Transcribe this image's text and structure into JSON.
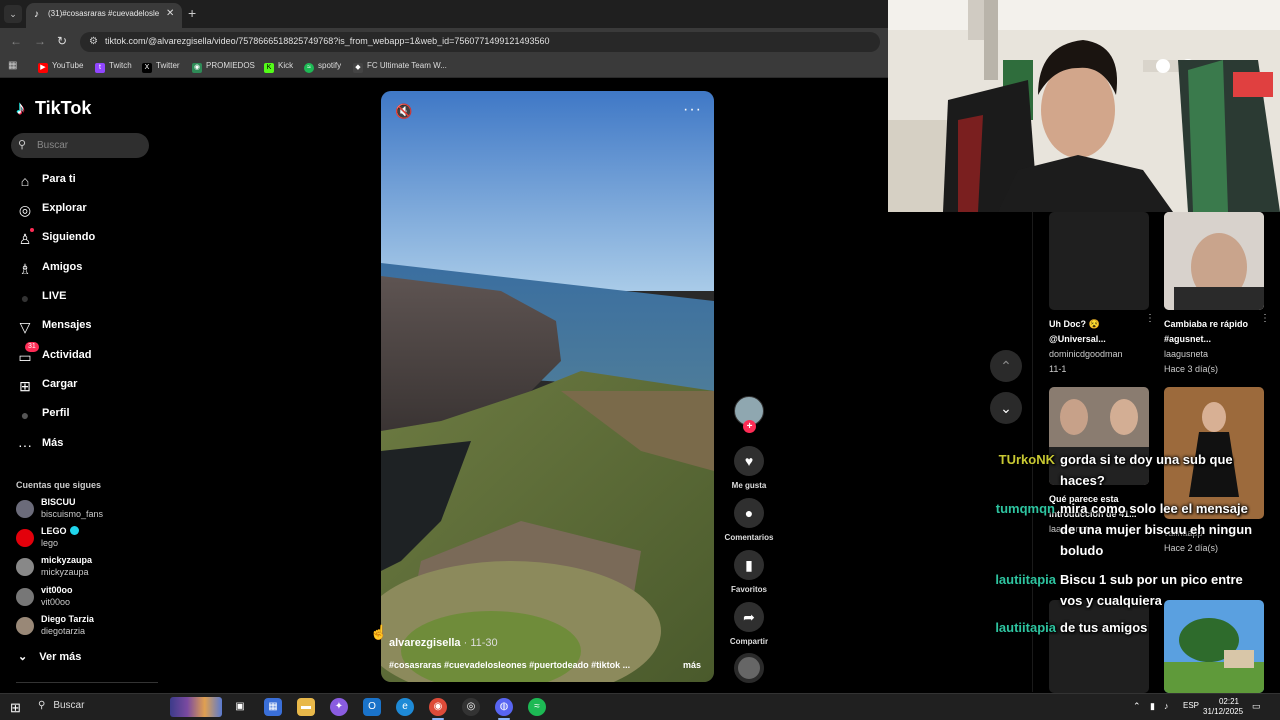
{
  "browser": {
    "tab_title": "(31)#cosasraras #cuevadelosle",
    "url": "tiktok.com/@alvarezgisella/video/7578666518825749768?is_from_webapp=1&web_id=7560771499121493560",
    "bookmarks": [
      {
        "label": "YouTube",
        "color": "#ff0000"
      },
      {
        "label": "Twitch",
        "color": "#9146ff"
      },
      {
        "label": "Twitter",
        "color": "#000000"
      },
      {
        "label": "PROMIEDOS",
        "color": "#2e8b57"
      },
      {
        "label": "Kick",
        "color": "#53fc18"
      },
      {
        "label": "spotify",
        "color": "#1db954"
      },
      {
        "label": "FC Ultimate Team W...",
        "color": "#444444"
      }
    ]
  },
  "tiktok": {
    "logo": "TikTok",
    "search_placeholder": "Buscar",
    "nav": [
      {
        "label": "Para ti",
        "icon": "home-icon"
      },
      {
        "label": "Explorar",
        "icon": "compass-icon"
      },
      {
        "label": "Siguiendo",
        "icon": "following-icon"
      },
      {
        "label": "Amigos",
        "icon": "friends-icon"
      },
      {
        "label": "LIVE",
        "icon": "live-icon"
      },
      {
        "label": "Mensajes",
        "icon": "messages-icon"
      },
      {
        "label": "Actividad",
        "icon": "activity-icon",
        "badge": "31"
      },
      {
        "label": "Cargar",
        "icon": "upload-icon"
      },
      {
        "label": "Perfil",
        "icon": "profile-icon"
      },
      {
        "label": "Más",
        "icon": "more-icon"
      }
    ],
    "following_title": "Cuentas que sigues",
    "following": [
      {
        "name": "BISCUU",
        "handle": "biscuismo_fans"
      },
      {
        "name": "LEGO",
        "handle": "lego",
        "verified": true
      },
      {
        "name": "mickyzaupa",
        "handle": "mickyzaupa"
      },
      {
        "name": "vit00oo",
        "handle": "vit00oo"
      },
      {
        "name": "Diego Tarzia",
        "handle": "diegotarzia"
      }
    ],
    "see_more": "Ver más"
  },
  "video": {
    "author": "alvarezgisella",
    "date": " · 11-30",
    "caption": "#cosasraras #cuevadelosleones #puertodeado #tiktok ...",
    "more": "más"
  },
  "actions": {
    "like": "Me gusta",
    "comments": "Comentarios",
    "favorites": "Favoritos",
    "share": "Compartir"
  },
  "recommended": [
    {
      "title": "Uh Doc? 😵@Universal...",
      "user": "dominicdgoodman",
      "when": "11-1"
    },
    {
      "title": "Cambiaba re rápido #agusnet...",
      "user": "laagusneta",
      "when": "Hace 3 día(s)"
    },
    {
      "title": "Qué parece esta introducción de 41...",
      "user": "laagusneta",
      "when": ""
    },
    {
      "title": "",
      "user": "valinaapp",
      "when": "Hace 2 día(s)"
    }
  ],
  "chat": [
    {
      "user": "TUrkoNK",
      "color": "#c8c832",
      "message": "gorda si te doy una sub que haces?"
    },
    {
      "user": "tumqmqn",
      "color": "#2ec4a0",
      "message": "mira como solo lee el mensaje de una mujer biscuu eh ningun boludo"
    },
    {
      "user": "lautiitapia",
      "color": "#2ec4a0",
      "message": "Biscu 1 sub por un pico entre vos y cualquiera"
    },
    {
      "user": "lautiitapia",
      "color": "#2ec4a0",
      "message": "de tus amigos"
    }
  ],
  "taskbar": {
    "search": "Buscar",
    "lang": "ESP",
    "time": "02:21",
    "date": "31/12/2025"
  }
}
